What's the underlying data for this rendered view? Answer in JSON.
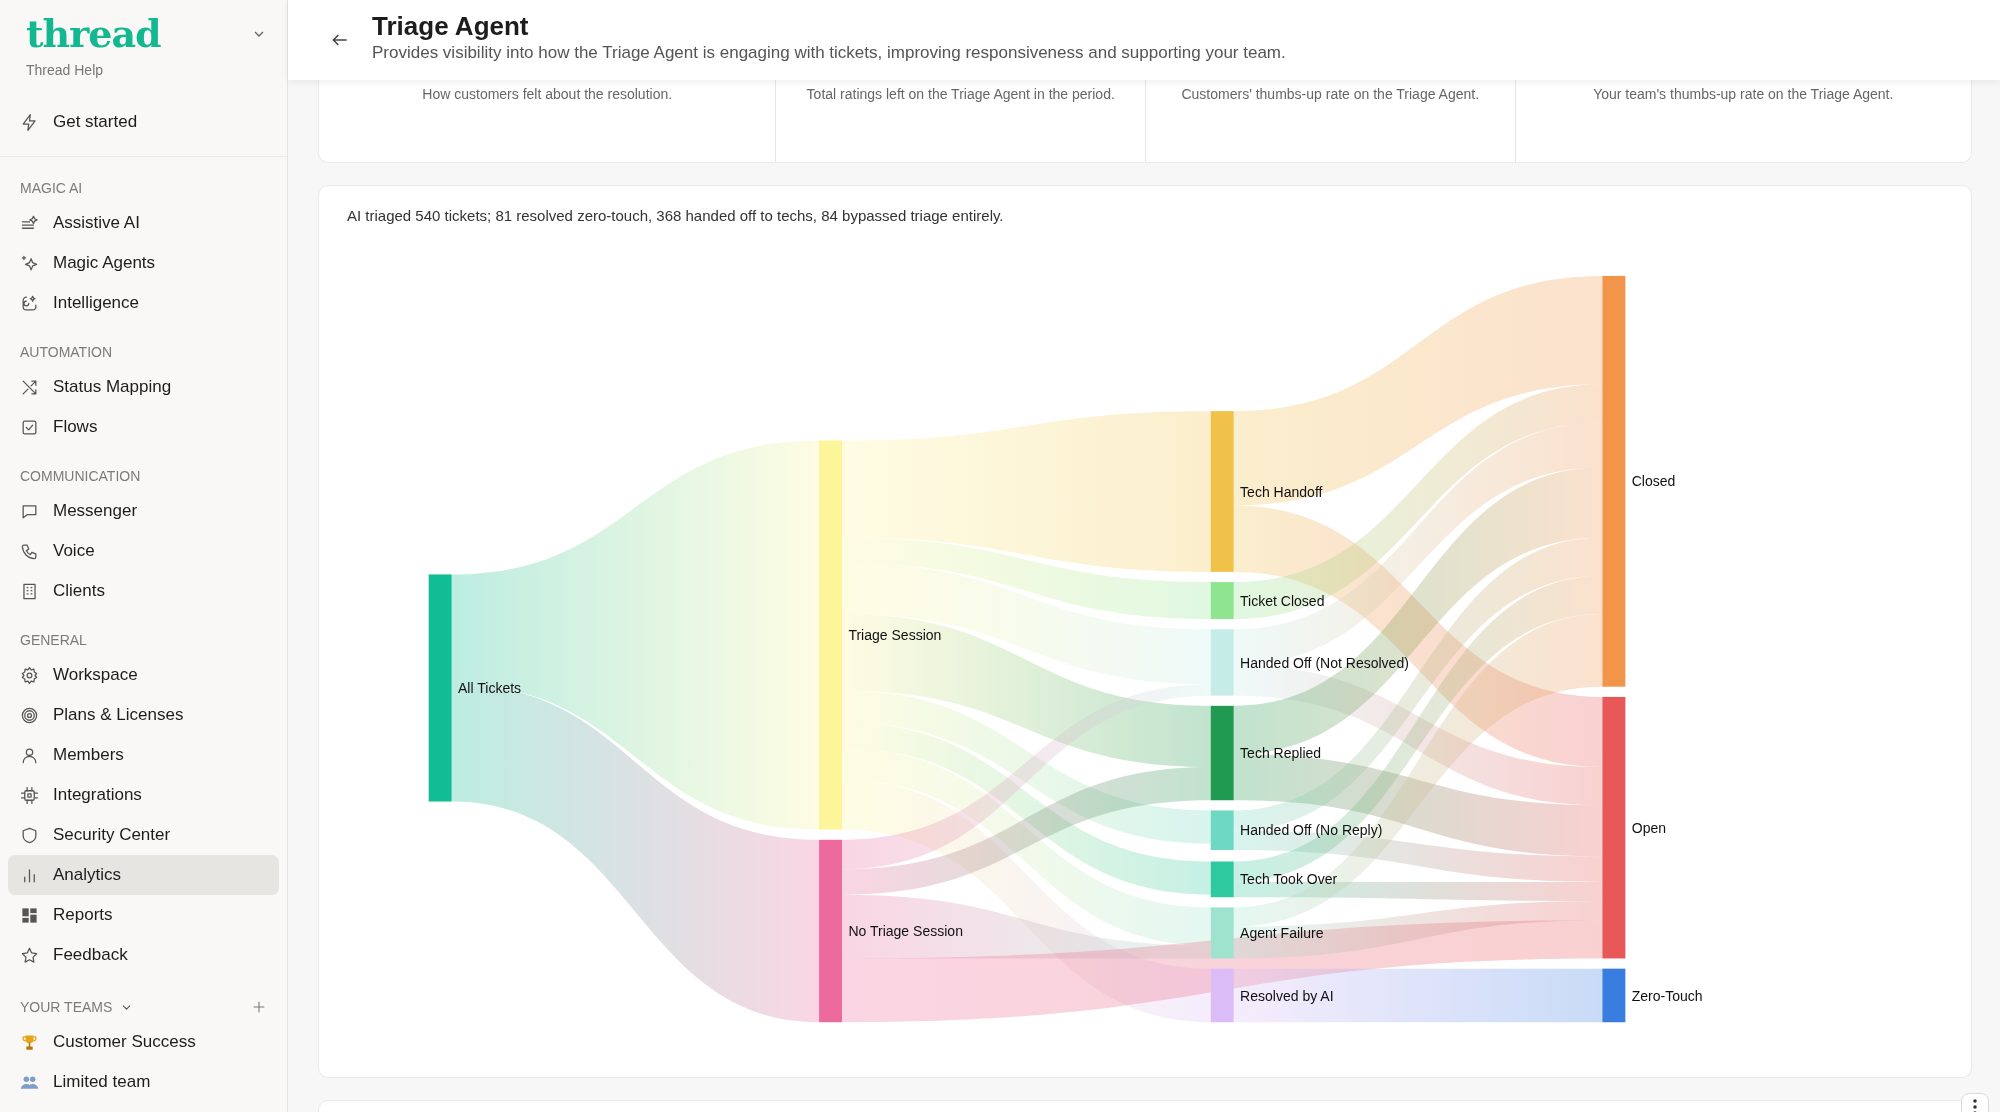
{
  "sidebar": {
    "logo": "thread",
    "workspace": "Thread Help",
    "top_items": [
      {
        "label": "Get started",
        "selected": false
      }
    ],
    "sections": [
      {
        "title": "MAGIC AI",
        "items": [
          {
            "label": "Assistive AI",
            "selected": false
          },
          {
            "label": "Magic Agents",
            "selected": false
          },
          {
            "label": "Intelligence",
            "selected": false
          }
        ]
      },
      {
        "title": "AUTOMATION",
        "items": [
          {
            "label": "Status Mapping",
            "selected": false
          },
          {
            "label": "Flows",
            "selected": false
          }
        ]
      },
      {
        "title": "COMMUNICATION",
        "items": [
          {
            "label": "Messenger",
            "selected": false
          },
          {
            "label": "Voice",
            "selected": false
          },
          {
            "label": "Clients",
            "selected": false
          }
        ]
      },
      {
        "title": "GENERAL",
        "items": [
          {
            "label": "Workspace",
            "selected": false
          },
          {
            "label": "Plans & Licenses",
            "selected": false
          },
          {
            "label": "Members",
            "selected": false
          },
          {
            "label": "Integrations",
            "selected": false
          },
          {
            "label": "Security Center",
            "selected": false
          },
          {
            "label": "Analytics",
            "selected": true
          },
          {
            "label": "Reports",
            "selected": false
          },
          {
            "label": "Feedback",
            "selected": false
          }
        ]
      }
    ],
    "teams": {
      "title": "YOUR TEAMS",
      "items": [
        {
          "label": "Customer Success",
          "selected": false
        },
        {
          "label": "Limited team",
          "selected": false
        }
      ]
    }
  },
  "header": {
    "title": "Triage Agent",
    "subtitle": "Provides visibility into how the Triage Agent is engaging with tickets, improving responsiveness and supporting your team."
  },
  "stat_descriptions": [
    "How customers felt about the resolution.",
    "Total ratings left on the Triage Agent in the period.",
    "Customers' thumbs-up rate on the Triage Agent.",
    "Your team's thumbs-up rate on the Triage Agent."
  ],
  "sankey": {
    "summary": "AI triaged 540 tickets; 81 resolved zero-touch, 368 handed off to techs, 84 bypassed triage entirely.",
    "nodes": [
      {
        "label": "All Tickets",
        "color": "#10bd94"
      },
      {
        "label": "Triage Session",
        "color": "#fdf59a"
      },
      {
        "label": "No Triage Session",
        "color": "#ec6a9c"
      },
      {
        "label": "Tech Handoff",
        "color": "#f0c24a"
      },
      {
        "label": "Ticket Closed",
        "color": "#8fe58f"
      },
      {
        "label": "Handed Off (Not Resolved)",
        "color": "#c6ece8"
      },
      {
        "label": "Tech Replied",
        "color": "#1f9a50"
      },
      {
        "label": "Handed Off (No Reply)",
        "color": "#6fd8c2"
      },
      {
        "label": "Tech Took Over",
        "color": "#2ec99e"
      },
      {
        "label": "Agent Failure",
        "color": "#9fe3cf"
      },
      {
        "label": "Resolved by AI",
        "color": "#dcbcf7"
      },
      {
        "label": "Closed",
        "color": "#f0954a"
      },
      {
        "label": "Open",
        "color": "#e85858"
      },
      {
        "label": "Zero-Touch",
        "color": "#3a7de0"
      }
    ]
  }
}
